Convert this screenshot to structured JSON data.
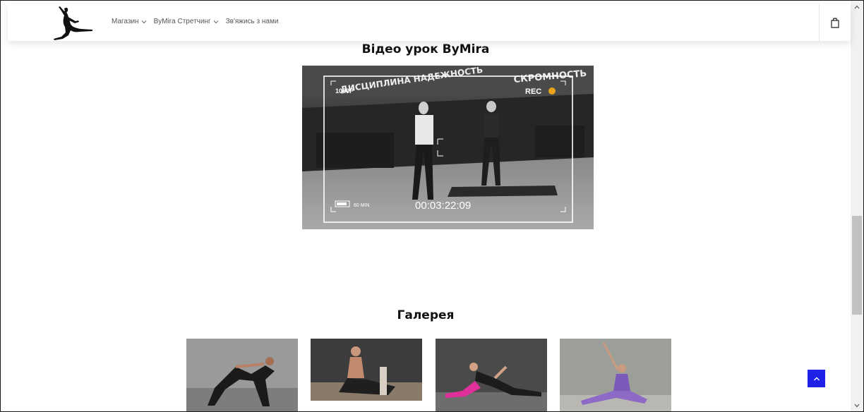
{
  "header": {
    "nav": [
      {
        "label": "Магазин",
        "has_dropdown": true
      },
      {
        "label": "ByMira Стретчинг",
        "has_dropdown": true
      },
      {
        "label": "Зв'яжись з нами",
        "has_dropdown": false
      }
    ],
    "cart_icon": "shopping-bag-icon"
  },
  "video_section": {
    "title": "Відео урок ByMira",
    "overlay": {
      "resolution": "1080P",
      "rec": "REC",
      "battery": "60 MIN",
      "timecode": "00:03:22:09",
      "wall_text_1": "ДИСЦИПЛИНА НАДЕЖНОСТЬ",
      "wall_text_2": "СКРОМНОСТЬ"
    }
  },
  "gallery": {
    "title": "Галерея",
    "image_count": 4
  },
  "back_to_top_icon": "chevron-up-icon",
  "colors": {
    "accent": "#1e22e6",
    "rec_dot": "#e8a31a"
  }
}
